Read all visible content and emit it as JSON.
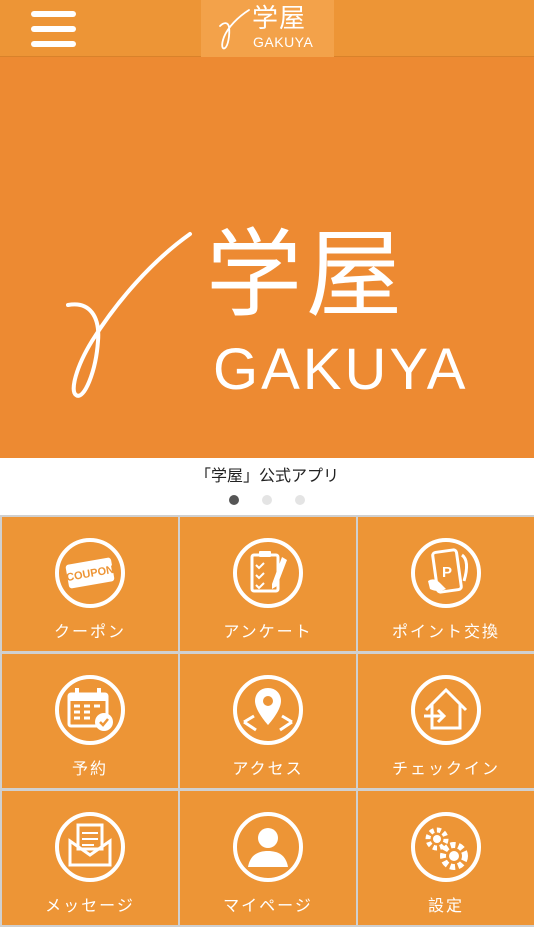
{
  "header": {
    "logo_kanji": "学屋",
    "logo_roman": "GAKUYA"
  },
  "banner": {
    "logo_kanji": "学屋",
    "logo_roman": "GAKUYA",
    "caption": "「学屋」公式アプリ",
    "slides": 3,
    "active_slide": 1
  },
  "menu": [
    {
      "label": "クーポン",
      "icon": "coupon-icon"
    },
    {
      "label": "アンケート",
      "icon": "survey-icon"
    },
    {
      "label": "ポイント交換",
      "icon": "point-exchange-icon"
    },
    {
      "label": "予約",
      "icon": "calendar-icon"
    },
    {
      "label": "アクセス",
      "icon": "map-pin-icon"
    },
    {
      "label": "チェックイン",
      "icon": "checkin-icon"
    },
    {
      "label": "メッセージ",
      "icon": "message-icon"
    },
    {
      "label": "マイページ",
      "icon": "user-icon"
    },
    {
      "label": "設定",
      "icon": "gear-icon"
    }
  ],
  "colors": {
    "accent": "#ED9536",
    "banner": "#ED8A32"
  },
  "coupon_text": "COUPON",
  "point_text": "P"
}
